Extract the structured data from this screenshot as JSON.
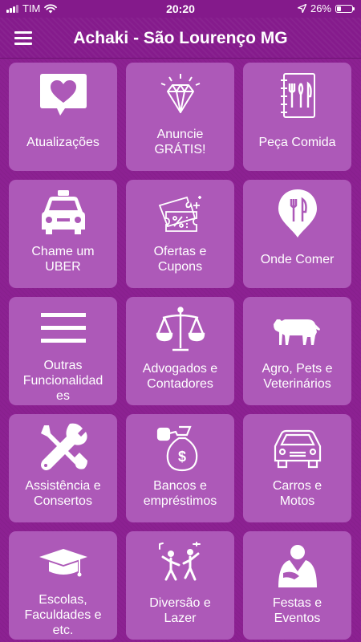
{
  "status_bar": {
    "carrier": "TIM",
    "time": "20:20",
    "battery": "26%"
  },
  "header": {
    "title": "Achaki - São Lourenço MG"
  },
  "tiles": [
    {
      "label": "Atualizações",
      "icon": "heart-chat-icon"
    },
    {
      "label": "Anuncie\nGRÁTIS!",
      "icon": "diamond-icon"
    },
    {
      "label": "Peça Comida",
      "icon": "menu-book-icon"
    },
    {
      "label": "Chame um\nUBER",
      "icon": "taxi-icon"
    },
    {
      "label": "Ofertas e\nCupons",
      "icon": "coupon-icon"
    },
    {
      "label": "Onde Comer",
      "icon": "restaurant-pin-icon"
    },
    {
      "label": "Outras\nFuncionalidad\nes",
      "icon": "menu-lines-icon"
    },
    {
      "label": "Advogados e\nContadores",
      "icon": "scales-icon"
    },
    {
      "label": "Agro, Pets e\nVeterinários",
      "icon": "cow-icon"
    },
    {
      "label": "Assistência e\nConsertos",
      "icon": "tools-icon"
    },
    {
      "label": "Bancos e\nempréstimos",
      "icon": "money-bag-icon"
    },
    {
      "label": "Carros e\nMotos",
      "icon": "car-icon"
    },
    {
      "label": "Escolas,\nFaculdades e\netc.",
      "icon": "graduation-cap-icon"
    },
    {
      "label": "Diversão e\nLazer",
      "icon": "dancing-icon"
    },
    {
      "label": "Festas e\nEventos",
      "icon": "host-icon"
    }
  ]
}
